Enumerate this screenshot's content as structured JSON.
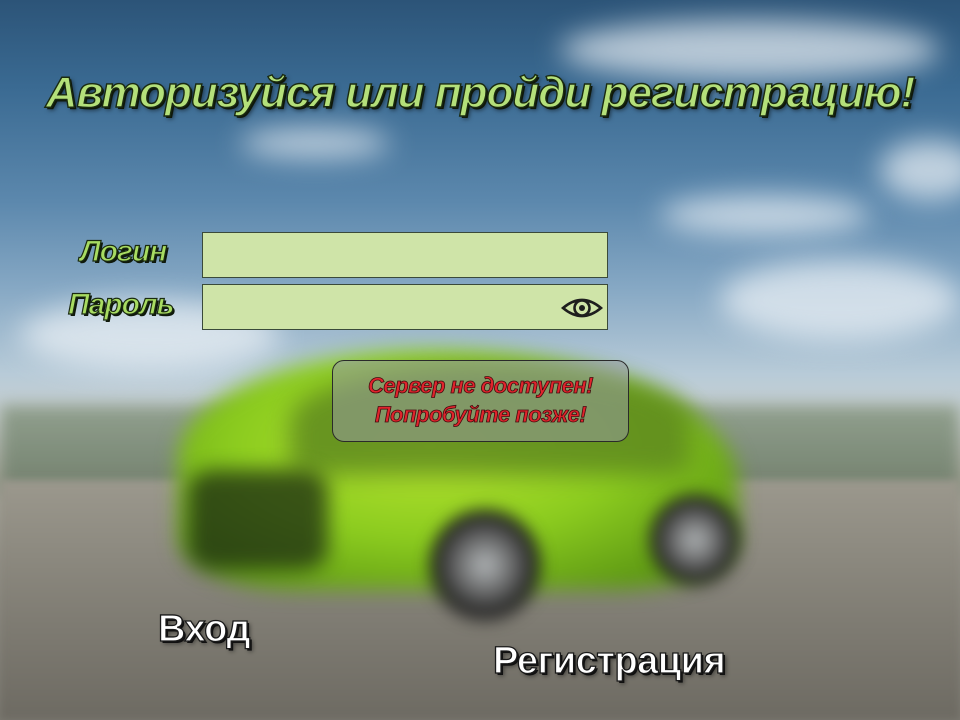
{
  "title": "Авторизуйся или пройди регистрацию!",
  "login": {
    "label": "Логин",
    "value": "",
    "placeholder": ""
  },
  "password": {
    "label": "Пароль",
    "value": "",
    "placeholder": "",
    "toggle_icon": "eye-icon"
  },
  "error": {
    "line1": "Сервер не доступен!",
    "line2": "Попробуйте позже!",
    "color": "#e0242c"
  },
  "actions": {
    "login_label": "Вход",
    "register_label": "Регистрация"
  },
  "colors": {
    "accent_green": "#b4e07a",
    "field_bg": "#cfe4a8"
  }
}
